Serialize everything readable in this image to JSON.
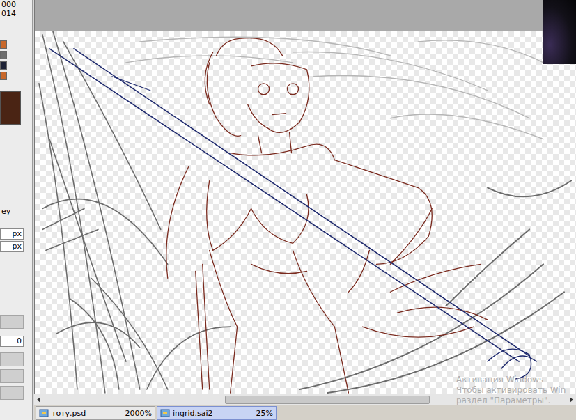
{
  "tool_panel": {
    "readouts": [
      "000",
      "014"
    ],
    "swatches": [
      {
        "color": "#c8672a"
      },
      {
        "color": "#6d6d6d"
      },
      {
        "color": "#1e2236"
      },
      {
        "color": "#c8672a"
      }
    ],
    "main_color": {
      "color": "#4a2414"
    },
    "mode_label": "ey",
    "size_fields": [
      "px",
      "px"
    ],
    "value_field": "0"
  },
  "canvas": {
    "scroll": {
      "level": 0.6
    }
  },
  "tabs": [
    {
      "label": "тоту.psd",
      "zoom": "2000%",
      "selected": false
    },
    {
      "label": "ingrid.sai2",
      "zoom": "25%",
      "selected": true
    }
  ],
  "watermark": {
    "lines": [
      "Активация Windows",
      "Чтобы активировать Win",
      "раздел \"Параметры\"."
    ]
  }
}
